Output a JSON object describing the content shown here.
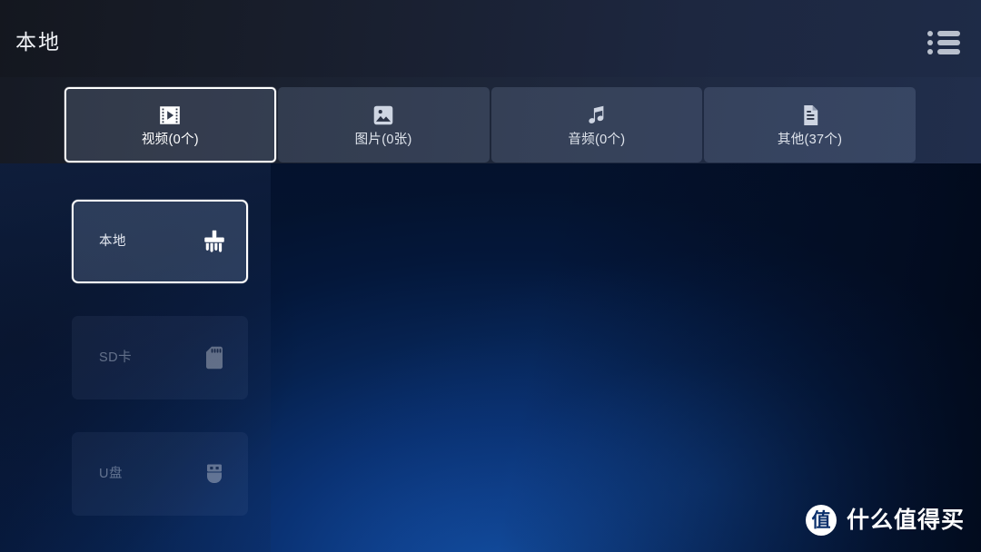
{
  "header": {
    "title": "本地",
    "menu_icon": "list-menu-icon"
  },
  "tabs": [
    {
      "label": "视频(0个)",
      "icon": "video-film-icon",
      "active": true
    },
    {
      "label": "图片(0张)",
      "icon": "image-picture-icon",
      "active": false
    },
    {
      "label": "音频(0个)",
      "icon": "music-note-icon",
      "active": false
    },
    {
      "label": "其他(37个)",
      "icon": "document-file-icon",
      "active": false
    }
  ],
  "sidebar": {
    "items": [
      {
        "label": "本地",
        "icon": "cleaning-brush-icon",
        "active": true,
        "enabled": true
      },
      {
        "label": "SD卡",
        "icon": "sd-card-icon",
        "active": false,
        "enabled": false
      },
      {
        "label": "U盘",
        "icon": "usb-drive-icon",
        "active": false,
        "enabled": false
      }
    ]
  },
  "watermark": {
    "logo_char": "值",
    "text": "什么值得买"
  },
  "colors": {
    "background_dark": "#04132f",
    "background_glow": "#1352a8",
    "header_gradient_start": "#14171f",
    "header_gradient_end": "#1e2b47",
    "accent_selected_border": "#ffffff",
    "text_primary": "#f0f2f6",
    "text_secondary": "#dfe4ec",
    "text_dim": "rgba(198,208,226,0.45)",
    "icon_color": "#ced5e2"
  }
}
